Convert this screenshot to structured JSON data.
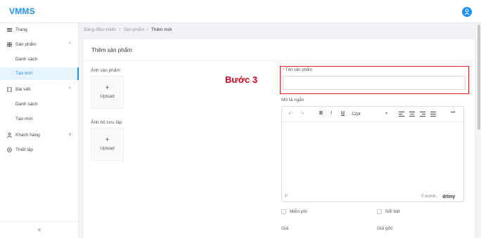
{
  "app": {
    "brand": "VMMS"
  },
  "sidebar": {
    "items": [
      {
        "label": "Trang",
        "icon": "dashboard-icon"
      },
      {
        "label": "Sản phẩm",
        "icon": "grid-icon",
        "arrow": "^"
      },
      {
        "label": "Danh sách"
      },
      {
        "label": "Tạo mới",
        "active": true
      },
      {
        "label": "Bài viết",
        "icon": "document-icon",
        "arrow": "^"
      },
      {
        "label": "Danh sách"
      },
      {
        "label": "Tạo mới"
      },
      {
        "label": "Khách hàng",
        "icon": "user-icon",
        "arrow": "v"
      },
      {
        "label": "Thiết lập",
        "icon": "gear-icon"
      }
    ],
    "collapse": "<"
  },
  "breadcrumb": {
    "items": [
      "Bảng điều khiển",
      "Sản phẩm",
      "Thêm mới"
    ],
    "separator": "/"
  },
  "page": {
    "title": "Thêm sản phẩm"
  },
  "form": {
    "product_image_label": "Ảnh sản phẩm",
    "gallery_label": "Ảnh bộ sưu tập",
    "upload_plus": "+",
    "upload_text": "Upload",
    "step_annotation": "Bước 3",
    "name_required_mark": "*",
    "name_label": "Tên sản phẩm",
    "short_desc_label": "Mô tả ngắn",
    "free_label": "Miễn phí",
    "featured_label": "Nổi bật",
    "price_label": "Giá",
    "original_price_label": "Giá gốc"
  },
  "editor": {
    "toolbar": {
      "undo": "↶",
      "redo": "↷",
      "bold": "B",
      "italic": "I",
      "underline": "U",
      "font_size": "12pt",
      "more": "•••"
    },
    "status": {
      "path": "P",
      "word_count": "0 words",
      "brand": "tiny"
    }
  },
  "colors": {
    "accent": "#1890ff",
    "annotation": "#d9001b"
  }
}
